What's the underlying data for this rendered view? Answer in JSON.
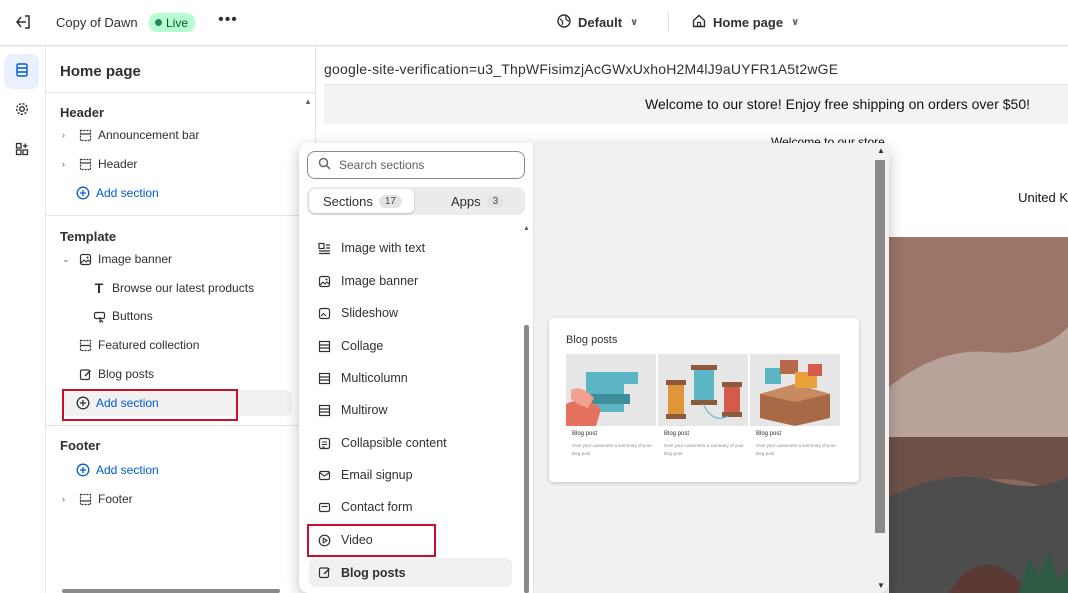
{
  "topbar": {
    "store_name": "Copy of Dawn",
    "status": "Live",
    "theme": "Default",
    "page": "Home page"
  },
  "sidebar": {
    "title": "Home page",
    "header_group": "Header",
    "header_items": [
      "Announcement bar",
      "Header"
    ],
    "add_section": "Add section",
    "template_group": "Template",
    "template_items": {
      "image_banner": "Image banner",
      "browse": "Browse our latest products",
      "buttons": "Buttons",
      "featured": "Featured collection",
      "blog": "Blog posts"
    },
    "footer_group": "Footer",
    "footer_item": "Footer"
  },
  "popup": {
    "search_placeholder": "Search sections",
    "tab_sections": "Sections",
    "tab_sections_count": "17",
    "tab_apps": "Apps",
    "tab_apps_count": "3",
    "items": [
      {
        "label": "Image with text",
        "icon": "image-with-text-icon"
      },
      {
        "label": "Image banner",
        "icon": "image-banner-icon"
      },
      {
        "label": "Slideshow",
        "icon": "slideshow-icon"
      },
      {
        "label": "Collage",
        "icon": "collage-icon"
      },
      {
        "label": "Multicolumn",
        "icon": "multicolumn-icon"
      },
      {
        "label": "Multirow",
        "icon": "multirow-icon"
      },
      {
        "label": "Collapsible content",
        "icon": "collapsible-icon"
      },
      {
        "label": "Email signup",
        "icon": "email-icon"
      },
      {
        "label": "Contact form",
        "icon": "contact-form-icon"
      },
      {
        "label": "Video",
        "icon": "video-icon"
      },
      {
        "label": "Blog posts",
        "icon": "blog-icon"
      }
    ],
    "preview": {
      "title": "Blog posts",
      "post_label": "Blog post",
      "post_desc": "Give your customers a summary of your blog post"
    }
  },
  "store_preview": {
    "verification": "google-site-verification=u3_ThpWFisimzjAcGWxUxhoH2M4lJ9aUYFR1A5t2wGE",
    "announcement": "Welcome to our store! Enjoy free shipping on orders over $50!",
    "announcement2": "Welcome to our store",
    "country": "United K"
  },
  "colors": {
    "accent": "#005bd3",
    "highlight": "#c8102e",
    "live_bg": "#b4fed2"
  }
}
